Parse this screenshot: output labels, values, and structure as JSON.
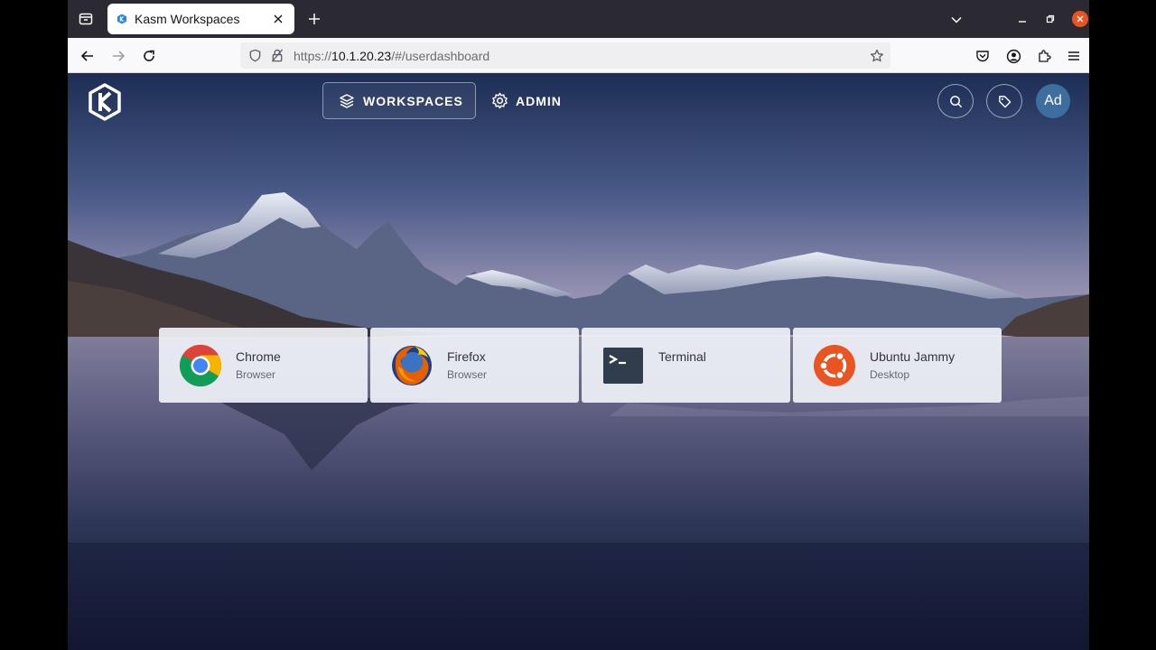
{
  "browser": {
    "tab_title": "Kasm Workspaces",
    "url_prefix": "https://",
    "url_host": "10.1.20.23",
    "url_path": "/#/userdashboard"
  },
  "header": {
    "workspaces_label": "WORKSPACES",
    "admin_label": "ADMIN",
    "avatar_initials": "Ad"
  },
  "workspaces": [
    {
      "name": "Chrome",
      "category": "Browser",
      "icon": "chrome-icon"
    },
    {
      "name": "Firefox",
      "category": "Browser",
      "icon": "firefox-icon"
    },
    {
      "name": "Terminal",
      "category": "",
      "icon": "terminal-icon"
    },
    {
      "name": "Ubuntu Jammy",
      "category": "Desktop",
      "icon": "ubuntu-icon"
    }
  ],
  "colors": {
    "ubuntu_orange": "#e95420",
    "avatar_bg": "#3d6e9e",
    "terminal_bg": "#2f3d4c"
  }
}
